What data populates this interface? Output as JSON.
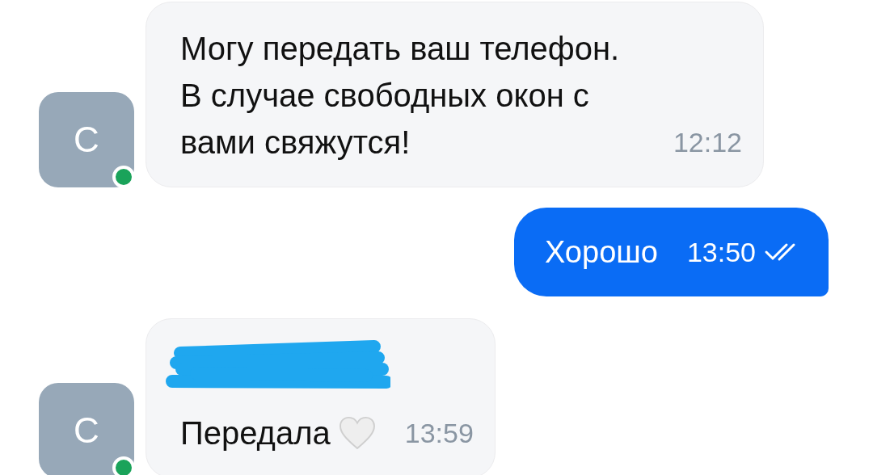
{
  "messages": [
    {
      "kind": "incoming",
      "avatar": "С",
      "online": true,
      "text": "Могу передать ваш телефон. В случае свободных окон с вами свяжутся!",
      "time": "12:12"
    },
    {
      "kind": "outgoing",
      "text": "Хорошо",
      "time": "13:50",
      "read": true
    },
    {
      "kind": "incoming",
      "avatar": "С",
      "online": true,
      "redacted": true,
      "text": "Передала",
      "heart": true,
      "time": "13:59"
    }
  ]
}
